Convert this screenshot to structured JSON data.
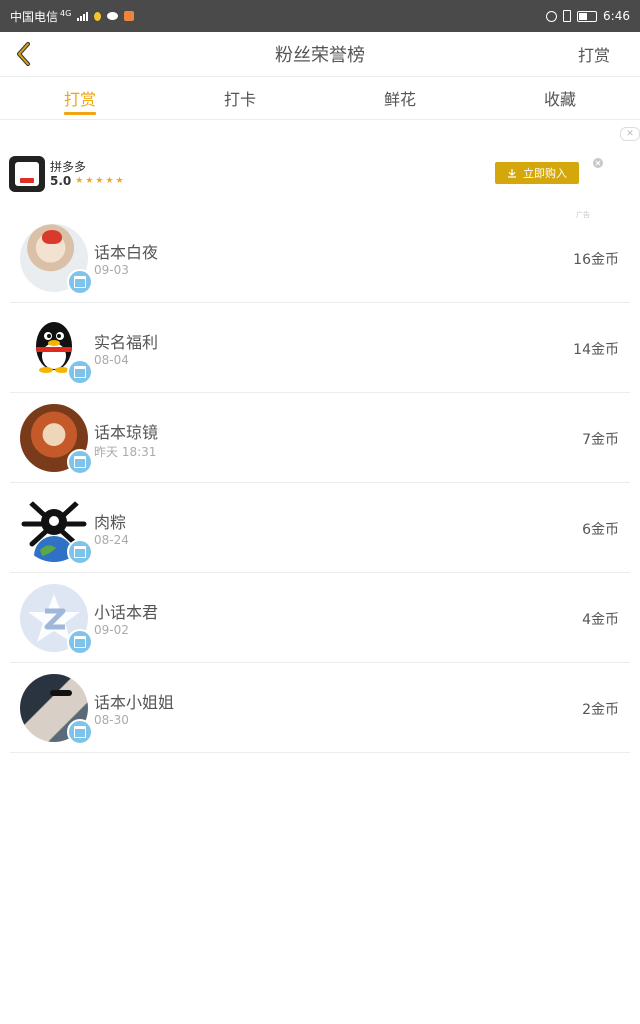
{
  "status_bar": {
    "carrier": "中国电信",
    "network": "4G",
    "time": "6:46"
  },
  "nav": {
    "title": "粉丝荣誉榜",
    "right_label": "打赏"
  },
  "tabs": [
    {
      "label": "打赏",
      "active": true
    },
    {
      "label": "打卡",
      "active": false
    },
    {
      "label": "鲜花",
      "active": false
    },
    {
      "label": "收藏",
      "active": false
    }
  ],
  "ad": {
    "app_name": "拼多多",
    "rating": "5.0",
    "button_label": "立即购入",
    "tag": "广告"
  },
  "fans": [
    {
      "name": "话本白夜",
      "date": "09-03",
      "amount": "16金币"
    },
    {
      "name": "实名福利",
      "date": "08-04",
      "amount": "14金币"
    },
    {
      "name": "话本琼镜",
      "date": "昨天 18:31",
      "amount": "7金币"
    },
    {
      "name": "肉粽",
      "date": "08-24",
      "amount": "6金币"
    },
    {
      "name": "小话本君",
      "date": "09-02",
      "amount": "4金币"
    },
    {
      "name": "话本小姐姐",
      "date": "08-30",
      "amount": "2金币"
    }
  ],
  "colors": {
    "accent": "#f1a414",
    "ad_button": "#d4a80d",
    "badge": "#7ec3ea"
  }
}
